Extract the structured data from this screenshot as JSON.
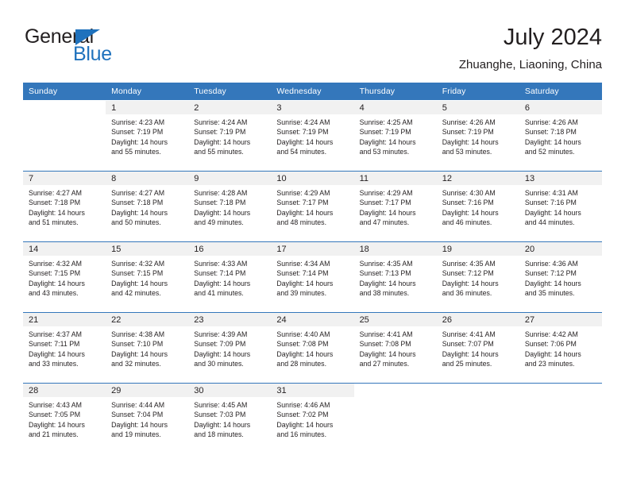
{
  "brand": {
    "word_one": "General",
    "word_two": "Blue",
    "triangle_color": "#1f72bd"
  },
  "header": {
    "title": "July 2024",
    "location": "Zhuanghe, Liaoning, China"
  },
  "theme": {
    "header_blue": "#3477bb",
    "daynum_band": "#f1f1f1",
    "text": "#231f20"
  },
  "weekday_headers": [
    "Sunday",
    "Monday",
    "Tuesday",
    "Wednesday",
    "Thursday",
    "Friday",
    "Saturday"
  ],
  "weeks": [
    [
      {
        "day": "",
        "sunrise": "",
        "sunset": "",
        "daylight1": "",
        "daylight2": "",
        "blank": true
      },
      {
        "day": "1",
        "sunrise": "Sunrise: 4:23 AM",
        "sunset": "Sunset: 7:19 PM",
        "daylight1": "Daylight: 14 hours",
        "daylight2": "and 55 minutes."
      },
      {
        "day": "2",
        "sunrise": "Sunrise: 4:24 AM",
        "sunset": "Sunset: 7:19 PM",
        "daylight1": "Daylight: 14 hours",
        "daylight2": "and 55 minutes."
      },
      {
        "day": "3",
        "sunrise": "Sunrise: 4:24 AM",
        "sunset": "Sunset: 7:19 PM",
        "daylight1": "Daylight: 14 hours",
        "daylight2": "and 54 minutes."
      },
      {
        "day": "4",
        "sunrise": "Sunrise: 4:25 AM",
        "sunset": "Sunset: 7:19 PM",
        "daylight1": "Daylight: 14 hours",
        "daylight2": "and 53 minutes."
      },
      {
        "day": "5",
        "sunrise": "Sunrise: 4:26 AM",
        "sunset": "Sunset: 7:19 PM",
        "daylight1": "Daylight: 14 hours",
        "daylight2": "and 53 minutes."
      },
      {
        "day": "6",
        "sunrise": "Sunrise: 4:26 AM",
        "sunset": "Sunset: 7:18 PM",
        "daylight1": "Daylight: 14 hours",
        "daylight2": "and 52 minutes."
      }
    ],
    [
      {
        "day": "7",
        "sunrise": "Sunrise: 4:27 AM",
        "sunset": "Sunset: 7:18 PM",
        "daylight1": "Daylight: 14 hours",
        "daylight2": "and 51 minutes."
      },
      {
        "day": "8",
        "sunrise": "Sunrise: 4:27 AM",
        "sunset": "Sunset: 7:18 PM",
        "daylight1": "Daylight: 14 hours",
        "daylight2": "and 50 minutes."
      },
      {
        "day": "9",
        "sunrise": "Sunrise: 4:28 AM",
        "sunset": "Sunset: 7:18 PM",
        "daylight1": "Daylight: 14 hours",
        "daylight2": "and 49 minutes."
      },
      {
        "day": "10",
        "sunrise": "Sunrise: 4:29 AM",
        "sunset": "Sunset: 7:17 PM",
        "daylight1": "Daylight: 14 hours",
        "daylight2": "and 48 minutes."
      },
      {
        "day": "11",
        "sunrise": "Sunrise: 4:29 AM",
        "sunset": "Sunset: 7:17 PM",
        "daylight1": "Daylight: 14 hours",
        "daylight2": "and 47 minutes."
      },
      {
        "day": "12",
        "sunrise": "Sunrise: 4:30 AM",
        "sunset": "Sunset: 7:16 PM",
        "daylight1": "Daylight: 14 hours",
        "daylight2": "and 46 minutes."
      },
      {
        "day": "13",
        "sunrise": "Sunrise: 4:31 AM",
        "sunset": "Sunset: 7:16 PM",
        "daylight1": "Daylight: 14 hours",
        "daylight2": "and 44 minutes."
      }
    ],
    [
      {
        "day": "14",
        "sunrise": "Sunrise: 4:32 AM",
        "sunset": "Sunset: 7:15 PM",
        "daylight1": "Daylight: 14 hours",
        "daylight2": "and 43 minutes."
      },
      {
        "day": "15",
        "sunrise": "Sunrise: 4:32 AM",
        "sunset": "Sunset: 7:15 PM",
        "daylight1": "Daylight: 14 hours",
        "daylight2": "and 42 minutes."
      },
      {
        "day": "16",
        "sunrise": "Sunrise: 4:33 AM",
        "sunset": "Sunset: 7:14 PM",
        "daylight1": "Daylight: 14 hours",
        "daylight2": "and 41 minutes."
      },
      {
        "day": "17",
        "sunrise": "Sunrise: 4:34 AM",
        "sunset": "Sunset: 7:14 PM",
        "daylight1": "Daylight: 14 hours",
        "daylight2": "and 39 minutes."
      },
      {
        "day": "18",
        "sunrise": "Sunrise: 4:35 AM",
        "sunset": "Sunset: 7:13 PM",
        "daylight1": "Daylight: 14 hours",
        "daylight2": "and 38 minutes."
      },
      {
        "day": "19",
        "sunrise": "Sunrise: 4:35 AM",
        "sunset": "Sunset: 7:12 PM",
        "daylight1": "Daylight: 14 hours",
        "daylight2": "and 36 minutes."
      },
      {
        "day": "20",
        "sunrise": "Sunrise: 4:36 AM",
        "sunset": "Sunset: 7:12 PM",
        "daylight1": "Daylight: 14 hours",
        "daylight2": "and 35 minutes."
      }
    ],
    [
      {
        "day": "21",
        "sunrise": "Sunrise: 4:37 AM",
        "sunset": "Sunset: 7:11 PM",
        "daylight1": "Daylight: 14 hours",
        "daylight2": "and 33 minutes."
      },
      {
        "day": "22",
        "sunrise": "Sunrise: 4:38 AM",
        "sunset": "Sunset: 7:10 PM",
        "daylight1": "Daylight: 14 hours",
        "daylight2": "and 32 minutes."
      },
      {
        "day": "23",
        "sunrise": "Sunrise: 4:39 AM",
        "sunset": "Sunset: 7:09 PM",
        "daylight1": "Daylight: 14 hours",
        "daylight2": "and 30 minutes."
      },
      {
        "day": "24",
        "sunrise": "Sunrise: 4:40 AM",
        "sunset": "Sunset: 7:08 PM",
        "daylight1": "Daylight: 14 hours",
        "daylight2": "and 28 minutes."
      },
      {
        "day": "25",
        "sunrise": "Sunrise: 4:41 AM",
        "sunset": "Sunset: 7:08 PM",
        "daylight1": "Daylight: 14 hours",
        "daylight2": "and 27 minutes."
      },
      {
        "day": "26",
        "sunrise": "Sunrise: 4:41 AM",
        "sunset": "Sunset: 7:07 PM",
        "daylight1": "Daylight: 14 hours",
        "daylight2": "and 25 minutes."
      },
      {
        "day": "27",
        "sunrise": "Sunrise: 4:42 AM",
        "sunset": "Sunset: 7:06 PM",
        "daylight1": "Daylight: 14 hours",
        "daylight2": "and 23 minutes."
      }
    ],
    [
      {
        "day": "28",
        "sunrise": "Sunrise: 4:43 AM",
        "sunset": "Sunset: 7:05 PM",
        "daylight1": "Daylight: 14 hours",
        "daylight2": "and 21 minutes."
      },
      {
        "day": "29",
        "sunrise": "Sunrise: 4:44 AM",
        "sunset": "Sunset: 7:04 PM",
        "daylight1": "Daylight: 14 hours",
        "daylight2": "and 19 minutes."
      },
      {
        "day": "30",
        "sunrise": "Sunrise: 4:45 AM",
        "sunset": "Sunset: 7:03 PM",
        "daylight1": "Daylight: 14 hours",
        "daylight2": "and 18 minutes."
      },
      {
        "day": "31",
        "sunrise": "Sunrise: 4:46 AM",
        "sunset": "Sunset: 7:02 PM",
        "daylight1": "Daylight: 14 hours",
        "daylight2": "and 16 minutes."
      },
      {
        "day": "",
        "sunrise": "",
        "sunset": "",
        "daylight1": "",
        "daylight2": "",
        "blank": true
      },
      {
        "day": "",
        "sunrise": "",
        "sunset": "",
        "daylight1": "",
        "daylight2": "",
        "blank": true
      },
      {
        "day": "",
        "sunrise": "",
        "sunset": "",
        "daylight1": "",
        "daylight2": "",
        "blank": true
      }
    ]
  ]
}
